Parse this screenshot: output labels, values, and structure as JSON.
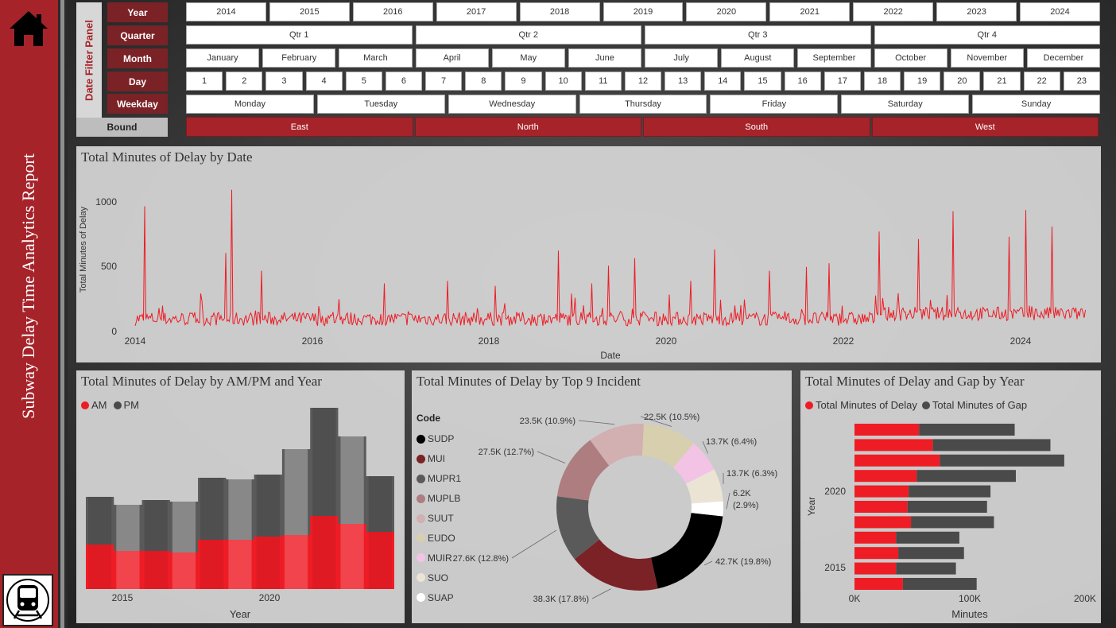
{
  "app": {
    "title": "Subway Delay Time Analytics Report"
  },
  "icons": {
    "home": "home-icon",
    "train": "subway-train-icon"
  },
  "colors": {
    "brand_red": "#a6232a",
    "am": "#ee1c25",
    "pm": "#4a4a4a"
  },
  "filters": {
    "panel_label": "Date Filter Panel",
    "labels": {
      "year": "Year",
      "quarter": "Quarter",
      "month": "Month",
      "day": "Day",
      "weekday": "Weekday",
      "bound": "Bound"
    },
    "years": [
      "2014",
      "2015",
      "2016",
      "2017",
      "2018",
      "2019",
      "2020",
      "2021",
      "2022",
      "2023",
      "2024"
    ],
    "quarters": [
      "Qtr 1",
      "Qtr 2",
      "Qtr 3",
      "Qtr 4"
    ],
    "months": [
      "January",
      "February",
      "March",
      "April",
      "May",
      "June",
      "July",
      "August",
      "September",
      "October",
      "November",
      "December"
    ],
    "days": [
      "1",
      "2",
      "3",
      "4",
      "5",
      "6",
      "7",
      "8",
      "9",
      "10",
      "11",
      "12",
      "13",
      "14",
      "15",
      "16",
      "17",
      "18",
      "19",
      "20",
      "21",
      "22",
      "23"
    ],
    "weekdays": [
      "Monday",
      "Tuesday",
      "Wednesday",
      "Thursday",
      "Friday",
      "Saturday",
      "Sunday"
    ],
    "bounds": [
      "East",
      "North",
      "South",
      "West"
    ]
  },
  "charts": {
    "by_date": {
      "title": "Total Minutes of Delay by Date",
      "xlabel": "Date",
      "ylabel": "Total Minutes of Delay",
      "xticks": [
        "2014",
        "2016",
        "2018",
        "2020",
        "2022",
        "2024"
      ],
      "yticks": [
        "0",
        "500",
        "1000"
      ]
    },
    "ampm": {
      "title": "Total Minutes of Delay by AM/PM and Year",
      "legend": [
        "AM",
        "PM"
      ],
      "xlabel": "Year",
      "xticks": [
        "2015",
        "2020"
      ]
    },
    "incident": {
      "title": "Total Minutes of Delay by Top 9 Incident",
      "legend_title": "Code"
    },
    "gap": {
      "title": "Total Minutes of Delay and Gap by Year",
      "legend": [
        "Total Minutes of Delay",
        "Total Minutes of Gap"
      ],
      "xlabel": "Minutes",
      "ylabel": "Year",
      "xticks": [
        "0K",
        "100K",
        "200K"
      ],
      "yticks": [
        "2020",
        "2015"
      ]
    }
  },
  "chart_data": [
    {
      "type": "line",
      "title": "Total Minutes of Delay by Date",
      "xlabel": "Date",
      "ylabel": "Total Minutes of Delay",
      "ylim": [
        0,
        1150
      ],
      "xlim": [
        "2014-01-01",
        "2024-12-31"
      ],
      "series": [
        {
          "name": "Total Minutes of Delay",
          "baseline": 100,
          "spikes": [
            {
              "x": "2014-02-10",
              "y": 990
            },
            {
              "x": "2014-10-05",
              "y": 300
            },
            {
              "x": "2015-02-10",
              "y": 1120
            },
            {
              "x": "2015-01-15",
              "y": 620
            },
            {
              "x": "2015-06-15",
              "y": 480
            },
            {
              "x": "2016-11-15",
              "y": 380
            },
            {
              "x": "2017-08-10",
              "y": 400
            },
            {
              "x": "2018-03-01",
              "y": 360
            },
            {
              "x": "2018-11-20",
              "y": 640
            },
            {
              "x": "2019-04-10",
              "y": 380
            },
            {
              "x": "2019-06-20",
              "y": 520
            },
            {
              "x": "2019-10-10",
              "y": 580
            },
            {
              "x": "2020-06-01",
              "y": 400
            },
            {
              "x": "2020-09-10",
              "y": 650
            },
            {
              "x": "2021-05-01",
              "y": 480
            },
            {
              "x": "2021-10-05",
              "y": 510
            },
            {
              "x": "2022-01-10",
              "y": 540
            },
            {
              "x": "2022-08-10",
              "y": 790
            },
            {
              "x": "2023-01-20",
              "y": 730
            },
            {
              "x": "2023-06-15",
              "y": 950
            },
            {
              "x": "2024-02-10",
              "y": 750
            },
            {
              "x": "2024-04-20",
              "y": 960
            },
            {
              "x": "2024-08-10",
              "y": 830
            }
          ]
        }
      ]
    },
    {
      "type": "area",
      "title": "Total Minutes of Delay by AM/PM and Year",
      "xlabel": "Year",
      "categories": [
        "2014",
        "2015",
        "2016",
        "2017",
        "2018",
        "2019",
        "2020",
        "2021",
        "2022",
        "2023",
        "2024"
      ],
      "series": [
        {
          "name": "AM",
          "values": [
            28,
            24,
            24,
            23,
            31,
            31,
            33,
            34,
            46,
            41,
            36
          ]
        },
        {
          "name": "PM",
          "values": [
            30,
            29,
            32,
            32,
            39,
            38,
            39,
            54,
            68,
            55,
            35
          ]
        }
      ]
    },
    {
      "type": "pie",
      "title": "Total Minutes of Delay by Top 9 Incident",
      "legend_title": "Code",
      "slices": [
        {
          "label": "SUDP",
          "value": 42.7,
          "text": "42.7K (19.8%)",
          "color": "#000000"
        },
        {
          "label": "MUI",
          "value": 38.3,
          "text": "38.3K (17.8%)",
          "color": "#7b2227"
        },
        {
          "label": "MUPR1",
          "value": 27.6,
          "text": "27.6K (12.8%)",
          "color": "#5a5a5a"
        },
        {
          "label": "MUPLB",
          "value": 27.5,
          "text": "27.5K (12.7%)",
          "color": "#ad7d80"
        },
        {
          "label": "SUUT",
          "value": 23.5,
          "text": "23.5K (10.9%)",
          "color": "#d2afb1"
        },
        {
          "label": "EUDO",
          "value": 22.5,
          "text": "22.5K (10.5%)",
          "color": "#d7cfae"
        },
        {
          "label": "MUIR",
          "value": 13.7,
          "text": "13.7K (6.4%)",
          "color": "#f3c3e6"
        },
        {
          "label": "SUO",
          "value": 13.7,
          "text": "13.7K (6.3%)",
          "color": "#ebe4d5"
        },
        {
          "label": "SUAP",
          "value": 6.2,
          "text": "6.2K\n(2.9%)",
          "color": "#ffffff"
        }
      ]
    },
    {
      "type": "bar",
      "orientation": "horizontal",
      "stacked": true,
      "title": "Total Minutes of Delay and Gap by Year",
      "xlabel": "Minutes",
      "ylabel": "Year",
      "xlim": [
        0,
        200000
      ],
      "categories": [
        "2024",
        "2023",
        "2022",
        "2021",
        "2020",
        "2019",
        "2018",
        "2017",
        "2016",
        "2015",
        "2014"
      ],
      "series": [
        {
          "name": "Total Minutes of Delay",
          "values": [
            56000,
            68000,
            74000,
            54000,
            47000,
            46000,
            49000,
            36000,
            38000,
            36000,
            42000
          ]
        },
        {
          "name": "Total Minutes of Gap",
          "values": [
            83000,
            102000,
            108000,
            86000,
            71000,
            69000,
            72000,
            55000,
            57000,
            52000,
            64000
          ]
        }
      ]
    }
  ]
}
